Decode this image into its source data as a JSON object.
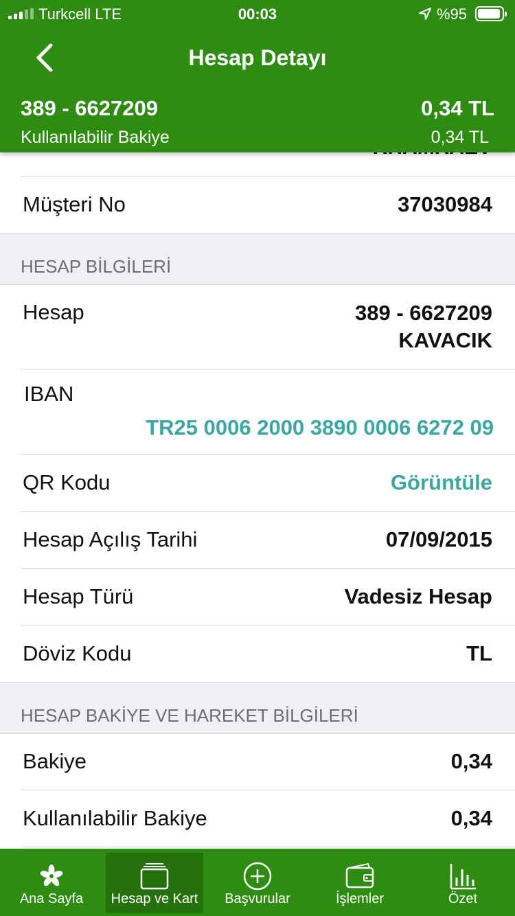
{
  "status_bar": {
    "carrier": "Turkcell  LTE",
    "time": "00:03",
    "battery": "%95"
  },
  "nav": {
    "title": "Hesap Detayı"
  },
  "summary": {
    "account": "389 - 6627209",
    "available_label": "Kullanılabilir Bakiye",
    "balance": "0,34 TL",
    "available_amount": "0,34 TL"
  },
  "customer": {
    "partial_name": "KHAMRAEV",
    "rows": [
      {
        "label": "Müşteri No",
        "value": "37030984"
      }
    ]
  },
  "account_section": {
    "title": "HESAP BİLGİLERİ",
    "account_label": "Hesap",
    "account_number": "389 - 6627209",
    "account_branch": "KAVACIK",
    "iban_label": "IBAN",
    "iban_value": "TR25 0006 2000 3890 0006 6272 09",
    "qr_label": "QR Kodu",
    "qr_action": "Görüntüle",
    "rows": [
      {
        "label": "Hesap Açılış Tarihi",
        "value": "07/09/2015"
      },
      {
        "label": "Hesap Türü",
        "value": "Vadesiz Hesap"
      },
      {
        "label": "Döviz Kodu",
        "value": "TL"
      }
    ]
  },
  "balance_section": {
    "title": "HESAP BAKİYE VE HAREKET BİLGİLERİ",
    "rows": [
      {
        "label": "Bakiye",
        "value": "0,34"
      },
      {
        "label": "Kullanılabilir Bakiye",
        "value": "0,34"
      }
    ]
  },
  "tabbar": {
    "active": "Hesap ve Kart",
    "items": [
      {
        "label": "Ana Sayfa",
        "icon": "flower-logo-icon"
      },
      {
        "label": "Hesap ve Kart",
        "icon": "cards-icon"
      },
      {
        "label": "Başvurular",
        "icon": "plus-circle-icon"
      },
      {
        "label": "İşlemler",
        "icon": "wallet-icon"
      },
      {
        "label": "Özet",
        "icon": "bar-chart-icon"
      }
    ]
  },
  "colors": {
    "brand_green": "#2e8c12",
    "active_tab": "#24710e",
    "link_teal": "#3aa7a7",
    "section_bg": "#efeff4"
  }
}
